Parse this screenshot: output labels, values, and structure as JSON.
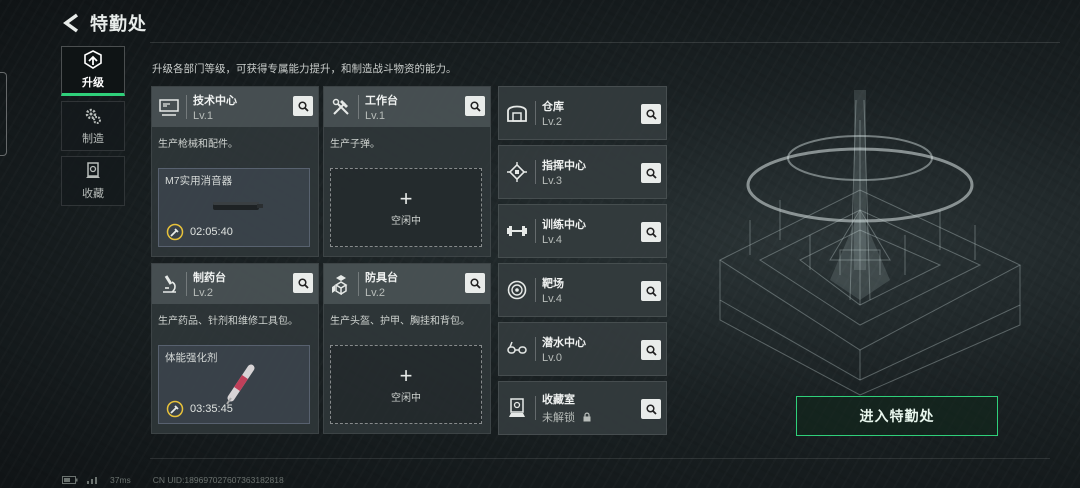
{
  "header": {
    "title": "特勤处"
  },
  "nav": [
    {
      "label": "升级",
      "icon": "upgrade-icon",
      "active": true
    },
    {
      "label": "制造",
      "icon": "gears-icon",
      "active": false
    },
    {
      "label": "收藏",
      "icon": "collection-icon",
      "active": false
    }
  ],
  "subtitle": "升级各部门等级，可获得专属能力提升，和制造战斗物资的能力。",
  "departments": [
    {
      "name": "技术中心",
      "level": "Lv.1",
      "desc": "生产枪械和配件。",
      "icon": "monitor-icon",
      "production": {
        "item": "M7实用消音器",
        "timer": "02:05:40"
      }
    },
    {
      "name": "工作台",
      "level": "Lv.1",
      "desc": "生产子弹。",
      "icon": "hammer-wrench-icon",
      "idle": {
        "label": "空闲中"
      }
    },
    {
      "name": "制药台",
      "level": "Lv.2",
      "desc": "生产药品、针剂和维修工具包。",
      "icon": "microscope-icon",
      "production": {
        "item": "体能强化剂",
        "timer": "03:35:45"
      }
    },
    {
      "name": "防具台",
      "level": "Lv.2",
      "desc": "生产头盔、护甲、胸挂和背包。",
      "icon": "armor-boxes-icon",
      "idle": {
        "label": "空闲中"
      }
    }
  ],
  "facilities": [
    {
      "name": "仓库",
      "level": "Lv.2",
      "icon": "warehouse-icon"
    },
    {
      "name": "指挥中心",
      "level": "Lv.3",
      "icon": "chip-icon"
    },
    {
      "name": "训练中心",
      "level": "Lv.4",
      "icon": "dumbbell-icon"
    },
    {
      "name": "靶场",
      "level": "Lv.4",
      "icon": "target-icon"
    },
    {
      "name": "潜水中心",
      "level": "Lv.0",
      "icon": "goggles-icon"
    },
    {
      "name": "收藏室",
      "level": "未解锁",
      "icon": "display-case-icon",
      "locked": true
    }
  ],
  "enter_button": "进入特勤处",
  "status": {
    "ping": "37ms",
    "uid": "CN UID:18969702760736318281​8"
  },
  "colors": {
    "accent": "#2fd07a",
    "card_bg": "#30383a",
    "card_head": "#4b5456"
  }
}
